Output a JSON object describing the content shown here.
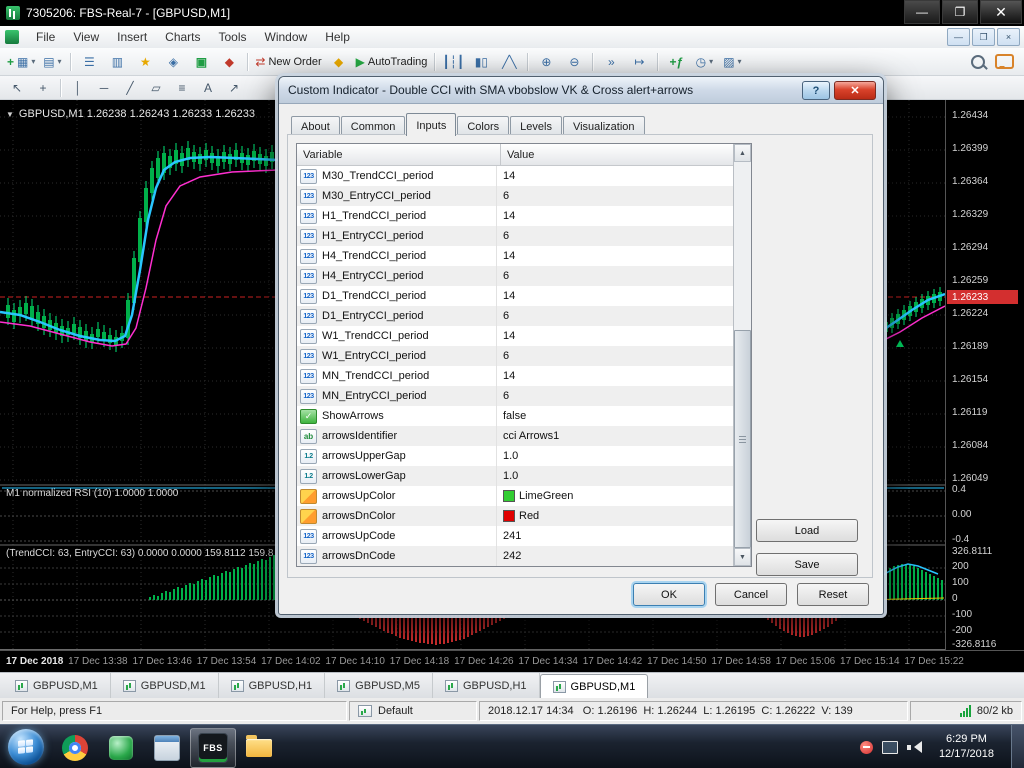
{
  "window": {
    "title": "7305206: FBS-Real-7 - [GBPUSD,M1]",
    "menu": [
      "File",
      "View",
      "Insert",
      "Charts",
      "Tools",
      "Window",
      "Help"
    ]
  },
  "toolbar": {
    "new_order": "New Order",
    "autotrading": "AutoTrading"
  },
  "icons": {
    "toolbar_main": [
      "new-chart-icon",
      "profiles-icon",
      "market-watch-icon",
      "data-window-icon",
      "navigator-icon",
      "terminal-icon",
      "strategy-tester-icon",
      "new-order-icon",
      "metaeditor-icon",
      "autotrading-icon",
      "bar-chart-icon",
      "candlestick-chart-icon",
      "line-chart-icon",
      "zoom-in-icon",
      "zoom-out-icon",
      "auto-scroll-icon",
      "chart-shift-icon",
      "indicators-icon",
      "templates-icon",
      "search-icon",
      "chat-icon"
    ],
    "line_tools": [
      "cursor-icon",
      "crosshair-icon",
      "vertical-line-icon",
      "horizontal-line-icon",
      "trendline-icon",
      "channel-icon",
      "fibonacci-icon",
      "text-icon",
      "arrows-icon"
    ],
    "tray": [
      "notification-icon",
      "network-icon",
      "volume-icon"
    ]
  },
  "chart": {
    "symbol_label": "GBPUSD,M1 1.26238 1.26243 1.26233 1.26233",
    "rsi_label": "M1 normalized RSI (10) 1.0000 1.0000",
    "cci_label": "(TrendCCI: 63, EntryCCI: 63) 0.0000 0.0000 159.8112 159.8",
    "current_price": "1.26233",
    "price_axis": [
      "1.26434",
      "1.26399",
      "1.26364",
      "1.26329",
      "1.26294",
      "1.26259",
      "1.26224",
      "1.26189",
      "1.26154",
      "1.26119",
      "1.26084",
      "1.26049"
    ],
    "rsi_axis": [
      "0.4",
      "0.00",
      "-0.4"
    ],
    "cci_axis": [
      "326.8111",
      "200",
      "100",
      "0",
      "-100",
      "-200",
      "-326.8116"
    ],
    "time_axis": [
      "17 Dec 2018",
      "17 Dec 13:38",
      "17 Dec 13:46",
      "17 Dec 13:54",
      "17 Dec 14:02",
      "17 Dec 14:10",
      "17 Dec 14:18",
      "17 Dec 14:26",
      "17 Dec 14:34",
      "17 Dec 14:42",
      "17 Dec 14:50",
      "17 Dec 14:58",
      "17 Dec 15:06",
      "17 Dec 15:14",
      "17 Dec 15:22"
    ]
  },
  "dialog": {
    "title": "Custom Indicator - Double CCI with SMA vbobslow VK & Cross alert+arrows",
    "tabs": [
      "About",
      "Common",
      "Inputs",
      "Colors",
      "Levels",
      "Visualization"
    ],
    "active_tab": "Inputs",
    "columns": {
      "variable": "Variable",
      "value": "Value"
    },
    "rows": [
      {
        "icon": "int-icon",
        "variable": "M30_TrendCCI_period",
        "value": "14"
      },
      {
        "icon": "int-icon",
        "variable": "M30_EntryCCI_period",
        "value": "6"
      },
      {
        "icon": "int-icon",
        "variable": "H1_TrendCCI_period",
        "value": "14"
      },
      {
        "icon": "int-icon",
        "variable": "H1_EntryCCI_period",
        "value": "6"
      },
      {
        "icon": "int-icon",
        "variable": "H4_TrendCCI_period",
        "value": "14"
      },
      {
        "icon": "int-icon",
        "variable": "H4_EntryCCI_period",
        "value": "6"
      },
      {
        "icon": "int-icon",
        "variable": "D1_TrendCCI_period",
        "value": "14"
      },
      {
        "icon": "int-icon",
        "variable": "D1_EntryCCI_period",
        "value": "6"
      },
      {
        "icon": "int-icon",
        "variable": "W1_TrendCCI_period",
        "value": "14"
      },
      {
        "icon": "int-icon",
        "variable": "W1_EntryCCI_period",
        "value": "6"
      },
      {
        "icon": "int-icon",
        "variable": "MN_TrendCCI_period",
        "value": "14"
      },
      {
        "icon": "int-icon",
        "variable": "MN_EntryCCI_period",
        "value": "6"
      },
      {
        "icon": "bool-icon",
        "variable": "ShowArrows",
        "value": "false"
      },
      {
        "icon": "string-icon",
        "variable": "arrowsIdentifier",
        "value": "cci Arrows1"
      },
      {
        "icon": "double-icon",
        "variable": "arrowsUpperGap",
        "value": "1.0"
      },
      {
        "icon": "double-icon",
        "variable": "arrowsLowerGap",
        "value": "1.0"
      },
      {
        "icon": "color-icon",
        "variable": "arrowsUpColor",
        "value": "LimeGreen",
        "swatch_style": "background:#32CD32"
      },
      {
        "icon": "color-icon",
        "variable": "arrowsDnColor",
        "value": "Red",
        "swatch_style": "background:#E00000"
      },
      {
        "icon": "int-icon",
        "variable": "arrowsUpCode",
        "value": "241"
      },
      {
        "icon": "int-icon",
        "variable": "arrowsDnCode",
        "value": "242"
      }
    ],
    "buttons": {
      "load": "Load",
      "save": "Save",
      "ok": "OK",
      "cancel": "Cancel",
      "reset": "Reset"
    }
  },
  "chart_tabs": [
    "GBPUSD,M1",
    "GBPUSD,M1",
    "GBPUSD,H1",
    "GBPUSD,M5",
    "GBPUSD,H1",
    "GBPUSD,M1"
  ],
  "status": {
    "help": "For Help, press F1",
    "profile": "Default",
    "quote": "2018.12.17 14:34   O: 1.26196  H: 1.26244  L: 1.26195  C: 1.26222  V: 139",
    "traffic": "80/2 kb"
  },
  "taskbar": {
    "fbs_label": "FBS",
    "clock_time": "6:29 PM",
    "clock_date": "12/17/2018"
  },
  "colors": {
    "candle_green": "#00c853",
    "histogram_red": "#e03131",
    "ma_cyan": "#29c5ff",
    "ma_magenta": "#ff2fd0",
    "price_line_red": "#cc2222",
    "arrow_up_color": "#32CD32",
    "arrow_dn_color": "#E00000"
  }
}
